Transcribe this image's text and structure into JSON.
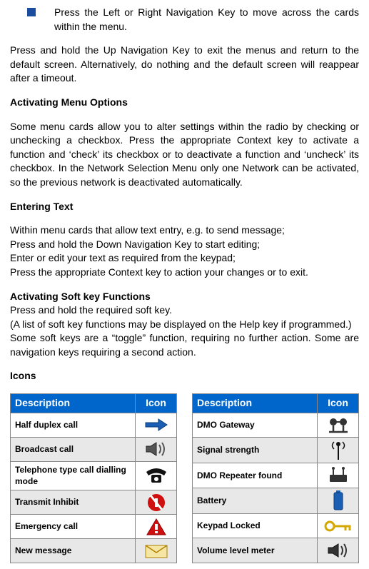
{
  "bullet": {
    "text": "Press the Left or Right Navigation Key to move across the cards within the menu."
  },
  "paragraphs": {
    "p1": "Press and hold the Up Navigation Key to exit the menus and return to the default screen. Alternatively, do nothing and the default screen will reappear after a timeout.",
    "p2": "Some menu cards allow you to alter settings within the radio by checking or unchecking a checkbox. Press the appropriate Context key to activate a function and ‘check’ its checkbox or to deactivate a function and ‘uncheck’ its checkbox. In the Network Selection Menu only one Network can be activated, so the previous network is deactivated automatically.",
    "p3a": "Within menu cards that allow text entry, e.g. to send message;",
    "p3b": "Press and hold the Down Navigation Key to start editing;",
    "p3c": "Enter or edit your text as required from the keypad;",
    "p3d": "Press the appropriate Context key to action your changes or to exit.",
    "p4a": "Press and hold the required soft key.",
    "p4b": "(A list of soft key functions may be displayed on the Help key if programmed.)",
    "p4c": "Some soft keys are a “toggle” function, requiring no further action. Some are navigation keys requiring a second action."
  },
  "headings": {
    "h1": "Activating Menu Options",
    "h2": "Entering Text",
    "h3": "Activating Soft key Functions",
    "h4": "Icons"
  },
  "tables": {
    "col_desc": "Description",
    "col_icon": "Icon",
    "left": [
      {
        "label": "Half duplex call",
        "icon": "arrow-right"
      },
      {
        "label": "Broadcast call",
        "icon": "speaker"
      },
      {
        "label": "Telephone type call dialling mode",
        "icon": "telephone"
      },
      {
        "label": "Transmit Inhibit",
        "icon": "no-transmit"
      },
      {
        "label": "Emergency call",
        "icon": "warning"
      },
      {
        "label": "New message",
        "icon": "envelope"
      }
    ],
    "right": [
      {
        "label": "DMO Gateway",
        "icon": "gateway"
      },
      {
        "label": "Signal strength",
        "icon": "antenna"
      },
      {
        "label": "DMO Repeater found",
        "icon": "repeater"
      },
      {
        "label": "Battery",
        "icon": "battery"
      },
      {
        "label": "Keypad Locked",
        "icon": "key"
      },
      {
        "label": "Volume level meter",
        "icon": "volume"
      }
    ]
  }
}
